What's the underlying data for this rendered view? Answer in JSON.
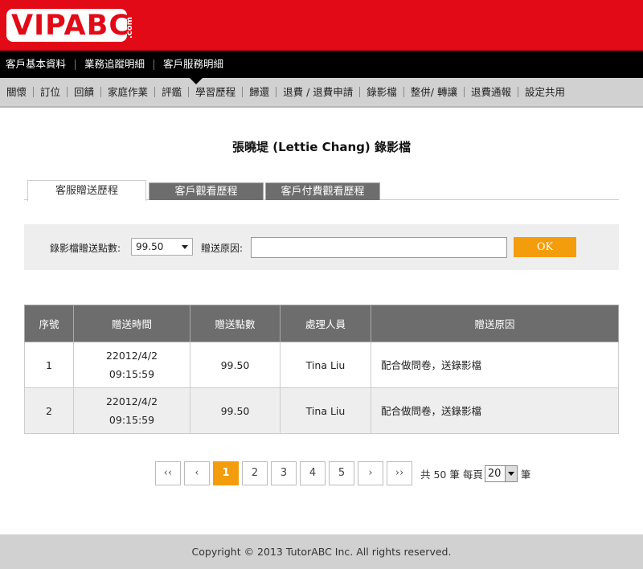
{
  "brand": {
    "logo_text": "VIPABC",
    "logo_suffix": ".com",
    "accent": "#e20a16",
    "orange": "#f39c0c"
  },
  "nav_primary": [
    {
      "label": "客戶基本資料"
    },
    {
      "label": "業務追蹤明細"
    },
    {
      "label": "客戶服務明細",
      "active": true
    }
  ],
  "nav_secondary": [
    {
      "label": "關懷"
    },
    {
      "label": "訂位"
    },
    {
      "label": "回饋"
    },
    {
      "label": "家庭作業"
    },
    {
      "label": "評鑑"
    },
    {
      "label": "學習歷程"
    },
    {
      "label": "歸還"
    },
    {
      "label": "退費 / 退費申請"
    },
    {
      "label": "錄影檔",
      "active": true
    },
    {
      "label": "整併/ 轉讓"
    },
    {
      "label": "退費通報"
    },
    {
      "label": "設定共用"
    }
  ],
  "page_title": "張曉堤 (Lettie Chang) 錄影檔",
  "tabs": [
    {
      "label": "客服贈送歷程",
      "active": true
    },
    {
      "label": "客戶觀看歷程"
    },
    {
      "label": "客戶付費觀看歷程"
    }
  ],
  "filter": {
    "points_label": "錄影檔贈送點數:",
    "points_value": "99.50",
    "reason_label": "贈送原因:",
    "reason_value": "",
    "ok_label": "OK"
  },
  "table": {
    "headers": [
      "序號",
      "贈送時間",
      "贈送點數",
      "處理人員",
      "贈送原因"
    ],
    "rows": [
      {
        "index": "1",
        "date": "22012/4/2",
        "time": "09:15:59",
        "points": "99.50",
        "staff": "Tina Liu",
        "reason": "配合做問卷，送錄影檔"
      },
      {
        "index": "2",
        "date": "22012/4/2",
        "time": "09:15:59",
        "points": "99.50",
        "staff": "Tina Liu",
        "reason": "配合做問卷，送錄影檔"
      }
    ]
  },
  "pagination": {
    "first": "‹‹",
    "prev": "‹",
    "next": "›",
    "last": "››",
    "pages": [
      "1",
      "2",
      "3",
      "4",
      "5"
    ],
    "current": "1",
    "total_text": "共 50 筆 每頁",
    "per_page": "20",
    "unit": "筆"
  },
  "footer": "Copyright © 2013 TutorABC Inc. All rights reserved."
}
